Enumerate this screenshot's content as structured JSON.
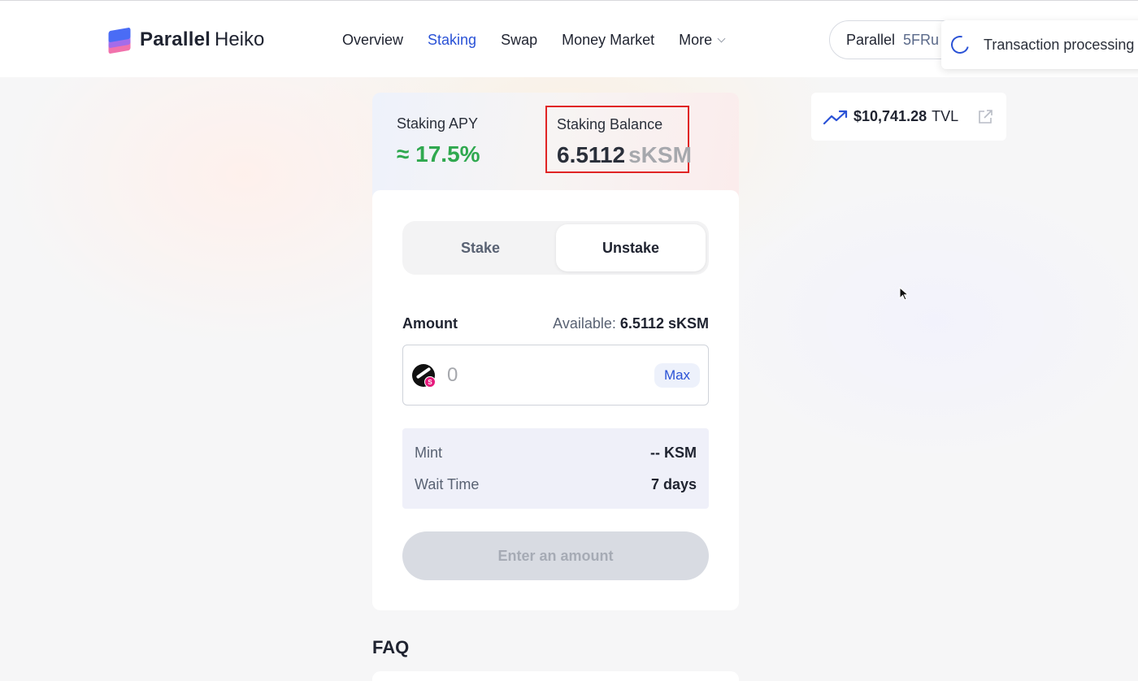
{
  "header": {
    "logo": {
      "brand": "Parallel",
      "product": "Heiko"
    },
    "nav": [
      {
        "label": "Overview",
        "active": false
      },
      {
        "label": "Staking",
        "active": true
      },
      {
        "label": "Swap",
        "active": false
      },
      {
        "label": "Money Market",
        "active": false
      }
    ],
    "more_label": "More",
    "account": {
      "network": "Parallel",
      "address": "5FRu"
    },
    "toast": {
      "text": "Transaction processing"
    }
  },
  "stats": {
    "apy_label": "Staking APY",
    "apy_value": "≈ 17.5%",
    "balance_label": "Staking Balance",
    "balance_value": "6.5112",
    "balance_unit": "sKSM"
  },
  "form": {
    "tabs": [
      {
        "label": "Stake",
        "active": false
      },
      {
        "label": "Unstake",
        "active": true
      }
    ],
    "amount_label": "Amount",
    "available_label": "Available:",
    "available_value": "6.5112 sKSM",
    "amount_placeholder": "0",
    "token_badge": "S",
    "max_label": "Max",
    "info": {
      "mint_label": "Mint",
      "mint_value": "-- KSM",
      "wait_label": "Wait Time",
      "wait_value": "7 days"
    },
    "submit_label": "Enter an amount"
  },
  "faq": {
    "title": "FAQ"
  },
  "tvl": {
    "value": "$10,741.28",
    "unit": "TVL",
    "icon": "trend-up-icon",
    "link_icon": "external-link-icon"
  },
  "colors": {
    "accent": "#2a52d6",
    "apy_green": "#2fa84f",
    "highlight_red": "#e02424",
    "disabled_button": "#d8dbe2"
  }
}
